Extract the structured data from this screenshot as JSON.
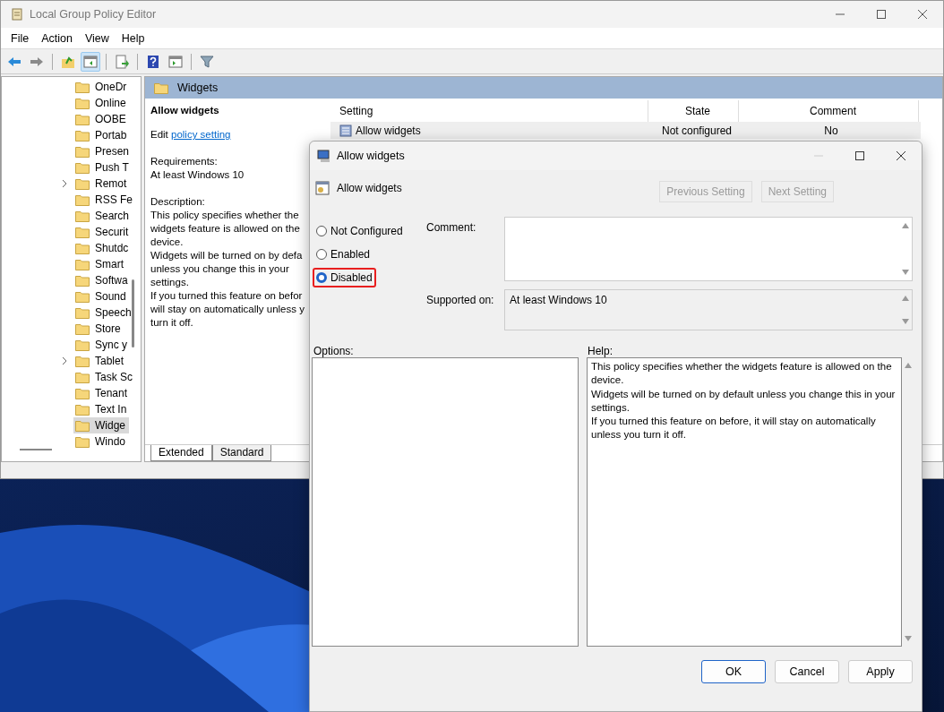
{
  "window": {
    "title": "Local Group Policy Editor"
  },
  "menu": [
    "File",
    "Action",
    "View",
    "Help"
  ],
  "toolbar": [
    {
      "kind": "back",
      "disabled": false,
      "pressed": false
    },
    {
      "kind": "forward",
      "disabled": true,
      "pressed": false
    },
    {
      "kind": "up",
      "pressed": false
    },
    {
      "kind": "tree",
      "pressed": true
    },
    {
      "kind": "export",
      "pressed": false
    },
    {
      "kind": "help",
      "pressed": false
    },
    {
      "kind": "pane",
      "pressed": false
    },
    {
      "kind": "filter",
      "pressed": false
    }
  ],
  "tree": [
    {
      "label": "OneDr",
      "expandable": false,
      "selected": false
    },
    {
      "label": "Online",
      "expandable": false,
      "selected": false
    },
    {
      "label": "OOBE",
      "expandable": false,
      "selected": false
    },
    {
      "label": "Portab",
      "expandable": false,
      "selected": false
    },
    {
      "label": "Presen",
      "expandable": false,
      "selected": false
    },
    {
      "label": "Push T",
      "expandable": false,
      "selected": false
    },
    {
      "label": "Remot",
      "expandable": true,
      "selected": false
    },
    {
      "label": "RSS Fe",
      "expandable": false,
      "selected": false
    },
    {
      "label": "Search",
      "expandable": false,
      "selected": false
    },
    {
      "label": "Securit",
      "expandable": false,
      "selected": false
    },
    {
      "label": "Shutdc",
      "expandable": false,
      "selected": false
    },
    {
      "label": "Smart",
      "expandable": false,
      "selected": false
    },
    {
      "label": "Softwa",
      "expandable": false,
      "selected": false
    },
    {
      "label": "Sound",
      "expandable": false,
      "selected": false
    },
    {
      "label": "Speech",
      "expandable": false,
      "selected": false
    },
    {
      "label": "Store",
      "expandable": false,
      "selected": false
    },
    {
      "label": "Sync y",
      "expandable": false,
      "selected": false
    },
    {
      "label": "Tablet",
      "expandable": true,
      "selected": false
    },
    {
      "label": "Task Sc",
      "expandable": false,
      "selected": false
    },
    {
      "label": "Tenant",
      "expandable": false,
      "selected": false
    },
    {
      "label": "Text In",
      "expandable": false,
      "selected": false
    },
    {
      "label": "Widge",
      "expandable": false,
      "selected": true
    },
    {
      "label": "Windo",
      "expandable": false,
      "selected": false
    }
  ],
  "pane": {
    "header": "Widgets",
    "policy_title": "Allow widgets",
    "edit_prefix": "Edit",
    "edit_link": "policy setting",
    "requirements_label": "Requirements:",
    "requirements": "At least Windows 10",
    "description_label": "Description:",
    "description_lines": [
      "This policy specifies whether the",
      "widgets feature is allowed on the",
      "device.",
      "Widgets will be turned on by defa",
      "unless you change this in your",
      "settings.",
      "If you turned this feature on befor",
      "will stay on automatically unless y",
      "turn it off."
    ]
  },
  "table": {
    "columns": [
      "Setting",
      "State",
      "Comment"
    ],
    "rows": [
      {
        "setting": "Allow widgets",
        "state": "Not configured",
        "comment": "No"
      }
    ]
  },
  "view_tabs": [
    {
      "label": "Extended",
      "selected": true
    },
    {
      "label": "Standard",
      "selected": false
    }
  ],
  "dialog": {
    "title": "Allow widgets",
    "setting_name": "Allow widgets",
    "nav_buttons": [
      {
        "label": "Previous Setting",
        "disabled": true
      },
      {
        "label": "Next Setting",
        "disabled": true
      }
    ],
    "options": [
      {
        "label": "Not Configured",
        "selected": false,
        "highlighted": false
      },
      {
        "label": "Enabled",
        "selected": false,
        "highlighted": false
      },
      {
        "label": "Disabled",
        "selected": true,
        "highlighted": true
      }
    ],
    "comment_label": "Comment:",
    "supported_label": "Supported on:",
    "supported_value": "At least Windows 10",
    "options_label": "Options:",
    "help_label": "Help:",
    "help_lines": [
      "This policy specifies whether the widgets feature is allowed on the device.",
      "Widgets will be turned on by default unless you change this in your settings.",
      "If you turned this feature on before, it will stay on automatically unless you turn it off."
    ],
    "buttons": [
      {
        "label": "OK",
        "default": true
      },
      {
        "label": "Cancel",
        "default": false
      },
      {
        "label": "Apply",
        "default": false
      }
    ]
  }
}
